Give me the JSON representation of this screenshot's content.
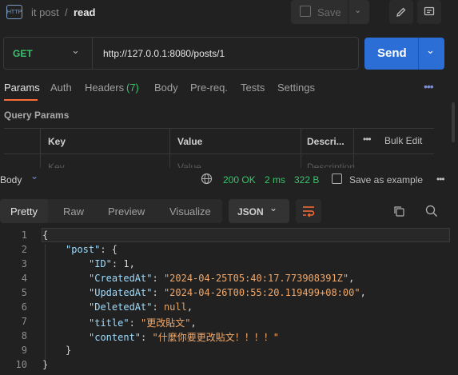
{
  "breadcrumb": {
    "collection": "it post",
    "separator": "/",
    "request": "read",
    "badge": "HTTP"
  },
  "toolbar": {
    "save_label": "Save"
  },
  "request": {
    "method": "GET",
    "url": "http://127.0.0.1:8080/posts/1",
    "send_label": "Send"
  },
  "tabs": {
    "params": "Params",
    "auth": "Auth",
    "headers": "Headers",
    "headers_count": "(7)",
    "body": "Body",
    "prereq": "Pre-req.",
    "tests": "Tests",
    "settings": "Settings"
  },
  "query": {
    "title": "Query Params",
    "col_key": "Key",
    "col_value": "Value",
    "col_desc": "Descri...",
    "bulk_edit": "Bulk Edit",
    "placeholder_key": "Key",
    "placeholder_value": "Value",
    "placeholder_desc": "Description"
  },
  "response": {
    "label": "Body",
    "status": "200 OK",
    "time": "2 ms",
    "size": "322 B",
    "save_example": "Save as example",
    "view_tabs": {
      "pretty": "Pretty",
      "raw": "Raw",
      "preview": "Preview",
      "visualize": "Visualize"
    },
    "format": "JSON",
    "line_numbers": [
      "1",
      "2",
      "3",
      "4",
      "5",
      "6",
      "7",
      "8",
      "9",
      "10"
    ],
    "json": {
      "post_key": "\"post\"",
      "id_key": "\"ID\"",
      "id_val": "1",
      "created_key": "\"CreatedAt\"",
      "created_val": "\"2024-04-25T05:40:17.773908391Z\"",
      "updated_key": "\"UpdatedAt\"",
      "updated_val": "\"2024-04-26T00:55:20.119499+08:00\"",
      "deleted_key": "\"DeletedAt\"",
      "deleted_val": "null",
      "title_key": "\"title\"",
      "title_val": "\"更改貼文\"",
      "content_key": "\"content\"",
      "content_val": "\"什麼你要更改貼文！！！！\""
    }
  },
  "colors": {
    "accent": "#ff6c37",
    "send": "#2b6fd6",
    "method": "#3ac26b",
    "status": "#3ac26b",
    "bg": "#212121"
  }
}
